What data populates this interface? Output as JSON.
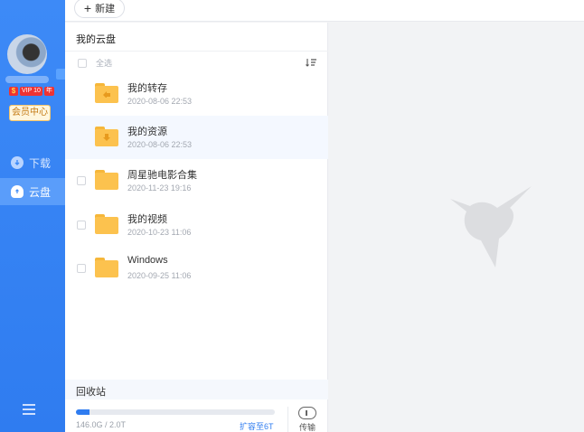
{
  "toolbar": {
    "new_label": "新建",
    "new_icon": "plus-icon"
  },
  "sidebar": {
    "vip_label": "VIP 10",
    "vip_extra": "年",
    "member_label": "会员中心",
    "items": [
      {
        "label": "下载",
        "icon": "download-icon",
        "active": false
      },
      {
        "label": "云盘",
        "icon": "cloud-icon",
        "active": true
      }
    ],
    "menu_icon": "hamburger-menu-icon"
  },
  "panel": {
    "title": "我的云盘",
    "select_all": "全选",
    "files": [
      {
        "name": "我的转存",
        "date": "2020-08-06 22:53",
        "icon": "folder-transfer-icon"
      },
      {
        "name": "我的资源",
        "date": "2020-08-06 22:53",
        "icon": "folder-download-icon"
      },
      {
        "name": "周星驰电影合集",
        "date": "2020-11-23 19:16",
        "icon": "folder-icon"
      },
      {
        "name": "我的视频",
        "date": "2020-10-23 11:06",
        "icon": "folder-icon"
      },
      {
        "name": "Windows",
        "date": "2020-09-25 11:06",
        "icon": "folder-icon"
      }
    ],
    "recycle_label": "回收站",
    "storage": {
      "used_text": "146.0G / 2.0T",
      "fraction": 0.07
    },
    "expand_label": "扩容至6T",
    "transfer_label": "传输"
  },
  "colors": {
    "accent": "#2f7cf0",
    "folder": "#fcc24e"
  }
}
